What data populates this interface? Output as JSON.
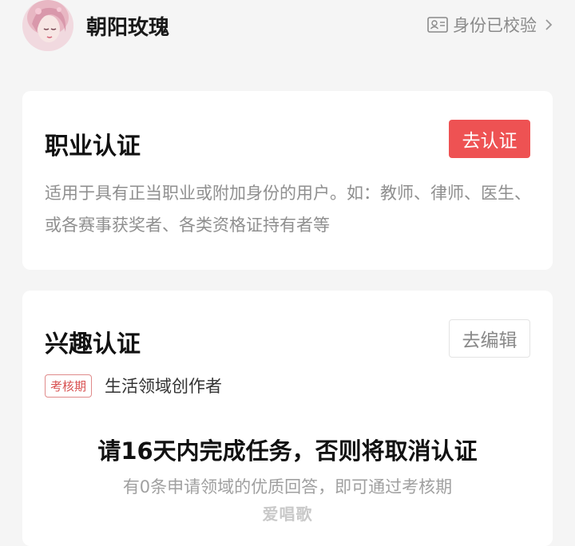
{
  "header": {
    "username": "朝阳玫瑰",
    "verified_label": "身份已校验",
    "avatar_icon": "avatar-portrait",
    "id_icon": "id-card-icon",
    "chevron_icon": "chevron-right-icon"
  },
  "professional": {
    "title": "职业认证",
    "button_label": "去认证",
    "description": "适用于具有正当职业或附加身份的用户。如：教师、律师、医生、或各赛事获奖者、各类资格证持有者等"
  },
  "interest": {
    "title": "兴趣认证",
    "button_label": "去编辑",
    "tag": "考核期",
    "field": "生活领域创作者",
    "task_title": "请16天内完成任务，否则将取消认证",
    "task_sub": "有0条申请领域的优质回答，即可通过考核期"
  },
  "watermark": "爱唱歌",
  "colors": {
    "accent_red": "#ee5253",
    "background": "#f5f5f5",
    "text_gray": "#8f8f8f"
  }
}
